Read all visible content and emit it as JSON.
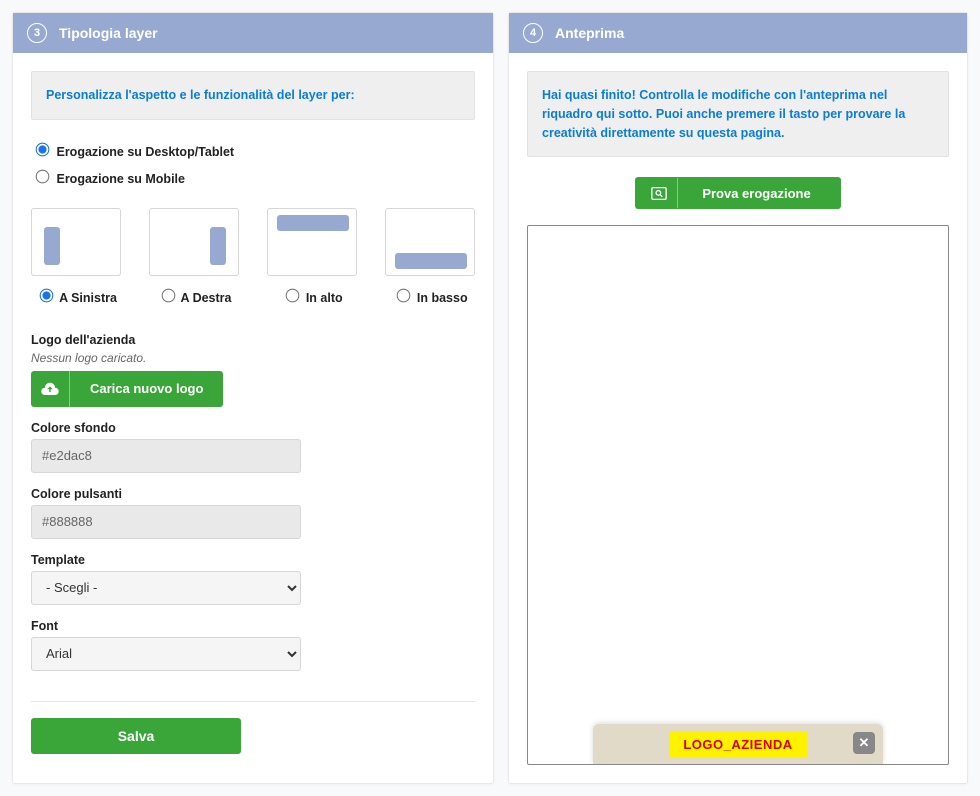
{
  "left_panel": {
    "step_number": "3",
    "title": "Tipologia layer",
    "info_text": "Personalizza l'aspetto e le funzionalità del layer per:",
    "radio_desktop": "Erogazione su Desktop/Tablet",
    "radio_mobile": "Erogazione su Mobile",
    "positions": {
      "left": "A Sinistra",
      "right": "A Destra",
      "top": "In alto",
      "bottom": "In basso"
    },
    "logo_label": "Logo dell'azienda",
    "logo_note": "Nessun logo caricato.",
    "upload_logo_btn": "Carica nuovo logo",
    "bg_color_label": "Colore sfondo",
    "bg_color_value": "#e2dac8",
    "btn_color_label": "Colore pulsanti",
    "btn_color_value": "#888888",
    "template_label": "Template",
    "template_value": "- Scegli -",
    "font_label": "Font",
    "font_value": "Arial",
    "save_btn": "Salva"
  },
  "right_panel": {
    "step_number": "4",
    "title": "Anteprima",
    "info_text": "Hai quasi finito! Controlla le modifiche con l'anteprima nel riquadro qui sotto. Puoi anche premere il tasto per provare la creatività direttamente su questa pagina.",
    "preview_btn": "Prova erogazione",
    "logo_placeholder": "LOGO_AZIENDA",
    "close_glyph": "✕"
  }
}
